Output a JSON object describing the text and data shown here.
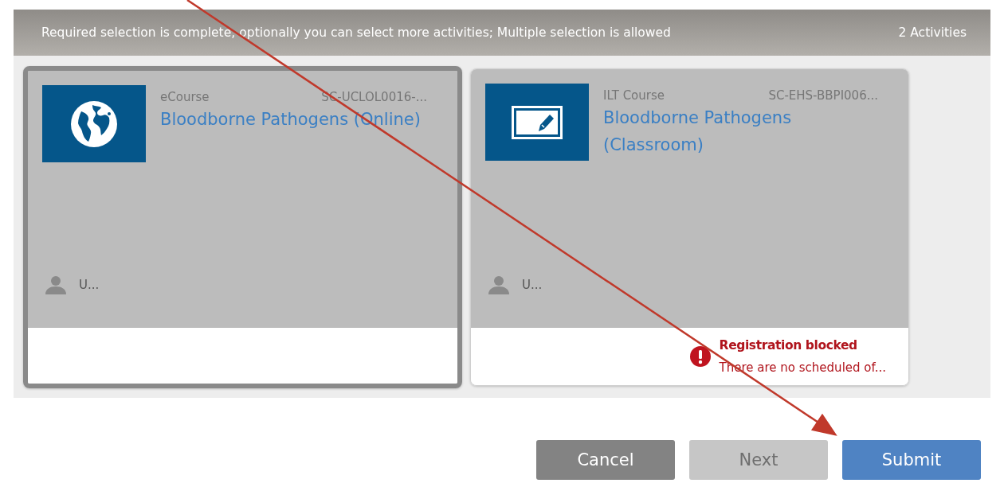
{
  "header": {
    "message": "Required selection is complete; optionally you can select more activities; Multiple selection is allowed",
    "count": "2 Activities"
  },
  "activities": [
    {
      "kind": "ecourse",
      "type": "eCourse",
      "code": "SC-UCLOL0016-...",
      "title": "Bloodborne Pathogens (Online)",
      "owner": "U...",
      "selected": true
    },
    {
      "kind": "ilt",
      "type": "ILT Course",
      "code": "SC-EHS-BBPI006...",
      "title": "Bloodborne Pathogens (Classroom)",
      "owner": "U...",
      "selected": false,
      "alert": {
        "title": "Registration blocked",
        "message": "There are no scheduled of..."
      }
    }
  ],
  "buttons": [
    {
      "kind": "secondary",
      "label": "Cancel",
      "disabled": false
    },
    {
      "kind": "secondary",
      "label": "Next",
      "disabled": true
    },
    {
      "kind": "primary",
      "label": "Submit",
      "disabled": false
    }
  ],
  "annotation": {
    "kind": "arrow"
  }
}
